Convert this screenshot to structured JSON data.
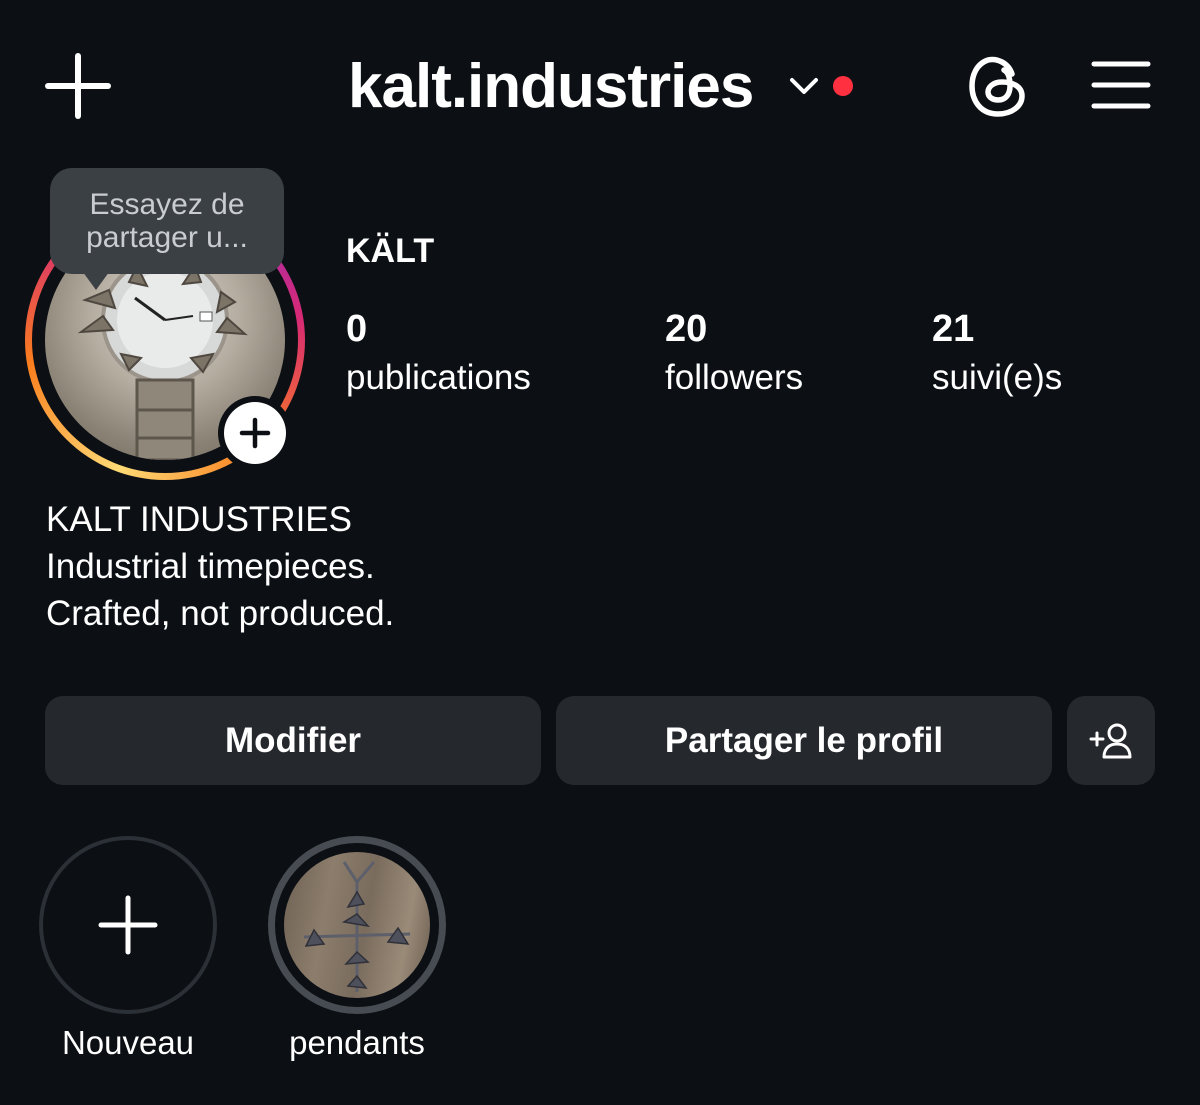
{
  "header": {
    "create_icon": "plus-icon",
    "username": "kalt.industries",
    "account_switcher_icon": "chevron-down-icon",
    "notification_dot_color": "#ff3040",
    "threads_icon": "threads-icon",
    "menu_icon": "hamburger-menu-icon"
  },
  "profile": {
    "tooltip_text_line1": "Essayez de",
    "tooltip_text_line2": "partager u...",
    "display_name": "KÄLT",
    "stats": [
      {
        "value": "0",
        "label": "publications"
      },
      {
        "value": "20",
        "label": "followers"
      },
      {
        "value": "21",
        "label": "suivi(e)s"
      }
    ],
    "story_ring_colors": [
      "#feda75",
      "#fa7e1e",
      "#d62976",
      "#962fbf"
    ]
  },
  "bio": {
    "line1": "KALT INDUSTRIES",
    "line2": "Industrial timepieces.",
    "line3": "Crafted, not produced."
  },
  "actions": {
    "edit_label": "Modifier",
    "share_label": "Partager le profil",
    "discover_icon": "add-person-icon"
  },
  "highlights": [
    {
      "label": "Nouveau",
      "icon": "plus-icon"
    },
    {
      "label": "pendants"
    }
  ]
}
